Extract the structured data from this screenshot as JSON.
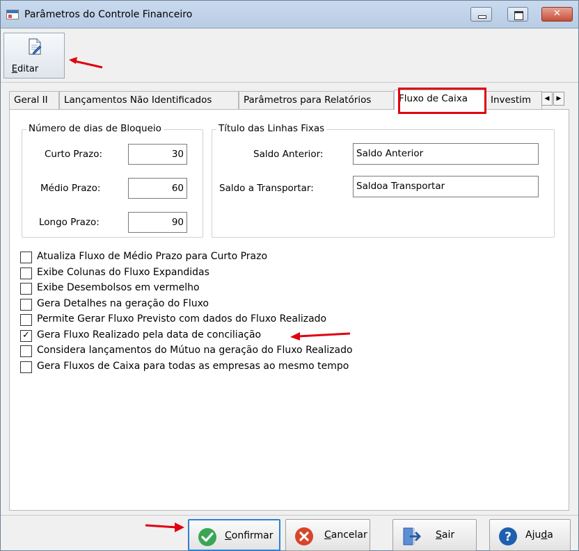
{
  "window": {
    "title": "Parâmetros do Controle Financeiro",
    "close_glyph": "✕",
    "minimize_icon": "minimize-icon",
    "maximize_icon": "maximize-icon",
    "close_icon": "close-icon"
  },
  "toolbar": {
    "edit_label_prefix": "",
    "edit_label_underlined": "E",
    "edit_label_rest": "ditar",
    "edit_icon": "edit-document-icon"
  },
  "tabs": [
    {
      "label": "Geral II",
      "active": false
    },
    {
      "label": "Lançamentos Não Identificados",
      "active": false
    },
    {
      "label": "Parâmetros para Relatórios",
      "active": false
    },
    {
      "label": "Fluxo de Caixa",
      "active": true
    },
    {
      "label": "Investim",
      "active": false
    }
  ],
  "tab_scroll": {
    "left_glyph": "◀",
    "right_glyph": "▶"
  },
  "bloqueio": {
    "legend": "Número de dias de Bloqueio",
    "curto_label": "Curto Prazo:",
    "curto_value": "30",
    "medio_label": "Médio Prazo:",
    "medio_value": "60",
    "longo_label": "Longo Prazo:",
    "longo_value": "90"
  },
  "linhas_fixas": {
    "legend": "Título das Linhas Fixas",
    "saldo_anterior_label": "Saldo Anterior:",
    "saldo_anterior_value": "Saldo Anterior",
    "saldo_transportar_label": "Saldo a Transportar:",
    "saldo_transportar_value": "Saldoa Transportar"
  },
  "options": [
    {
      "label": "Atualiza Fluxo de Médio Prazo para Curto Prazo",
      "checked": false
    },
    {
      "label": "Exibe Colunas do Fluxo Expandidas",
      "checked": false
    },
    {
      "label": "Exibe Desembolsos  em vermelho",
      "checked": false
    },
    {
      "label": "Gera Detalhes na geração do Fluxo",
      "checked": false
    },
    {
      "label": "Permite Gerar Fluxo Previsto com dados do Fluxo Realizado",
      "checked": false
    },
    {
      "label": "Gera Fluxo Realizado pela data de conciliação",
      "checked": true
    },
    {
      "label": "Considera lançamentos do Mútuo na geração do Fluxo Realizado",
      "checked": false
    },
    {
      "label": "Gera Fluxos de Caixa para todas as empresas ao mesmo tempo",
      "checked": false
    }
  ],
  "check_glyph": "✓",
  "buttons": {
    "confirmar": {
      "u": "C",
      "rest": "onfirmar",
      "icon": "check-circle-icon"
    },
    "cancelar": {
      "u": "C",
      "rest": "ancelar",
      "icon": "cancel-circle-icon"
    },
    "sair": {
      "u": "S",
      "rest": "air",
      "icon": "exit-door-icon"
    },
    "ajuda_prefix": "Aju",
    "ajuda_u": "d",
    "ajuda_rest": "a",
    "ajuda_icon": "help-circle-icon"
  },
  "annotations": {
    "color": "#e0000f",
    "arrow_icon": "red-arrow-icon"
  },
  "colors": {
    "confirm_green": "#3aa655",
    "cancel_red": "#d9442a",
    "help_blue": "#1f5fb0",
    "focus_blue": "#2f7fd1"
  }
}
